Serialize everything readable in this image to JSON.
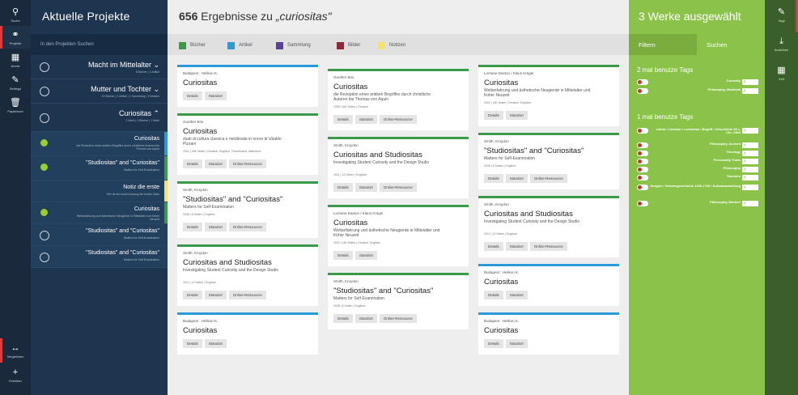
{
  "left_rail": {
    "items": [
      {
        "icon": "search-icon",
        "glyph": "⚲",
        "label": "Suche"
      },
      {
        "icon": "link-icon",
        "glyph": "⚭",
        "label": "Projekte"
      },
      {
        "icon": "grid-icon",
        "glyph": "▦",
        "label": "Archiv"
      },
      {
        "icon": "wrench-icon",
        "glyph": "✎",
        "label": "Settings"
      },
      {
        "icon": "trash-icon",
        "glyph": "🗑",
        "label": "Papierkorb"
      }
    ],
    "bottom": [
      {
        "icon": "compare-icon",
        "glyph": "↔",
        "label": "Vergleichen"
      },
      {
        "icon": "plus-icon",
        "glyph": "+",
        "label": "Erstellen"
      }
    ]
  },
  "projects_panel": {
    "title": "Aktuelle Projekte",
    "search_placeholder": "In den Projekten Suchen",
    "projects": [
      {
        "name": "Macht im Mittelalter ⌄",
        "meta": "8 Bücher | 1 Artikel",
        "filled": false,
        "stripe": ""
      },
      {
        "name": "Mutter und Tochter ⌄",
        "meta": "10 Bücher | 1 Artikel | 1 Sammlung | 3 Notizen",
        "filled": false,
        "stripe": ""
      },
      {
        "name": "Curiositas ⌃",
        "meta": "1 Werk | 4 Bücher | 1 Notiz",
        "filled": false,
        "stripe": ""
      },
      {
        "name": "Curiositas",
        "meta": "die Rezeption eines antiken Begriffes durch christliche Autoren bis Thomas von Aquin",
        "filled": true,
        "stripe": "#2b9ad8"
      },
      {
        "name": "\"Studiositas\" and \"Curiositas\"",
        "meta": "Matters for Self-Examination",
        "filled": true,
        "stripe": "#3a9a4a"
      },
      {
        "name": "Notiz die erste",
        "meta": "Hier ist ein kurzer Auszug der ersten Notiz",
        "filled": false,
        "nodot": true,
        "stripe": "#f3e36b"
      },
      {
        "name": "Curiositas",
        "meta": "Weltanfahrung und ästhetische Neugierde in Mittelalter und früher Neuzeit",
        "filled": true,
        "stripe": "#3a9a4a"
      },
      {
        "name": "\"Studiositas\" and \"Curiositas\"",
        "meta": "Matters for Self-Examination",
        "filled": false,
        "stripe": ""
      },
      {
        "name": "\"Studiositas\" and \"Curiositas\"",
        "meta": "Matters for Self-Examination",
        "filled": false,
        "stripe": ""
      }
    ]
  },
  "main": {
    "count": "656",
    "title_mid": " Ergebnisse zu ",
    "query": "„curiositas\"",
    "legend": [
      {
        "label": "Bücher",
        "color": "#3a9a4a"
      },
      {
        "label": "Artikel",
        "color": "#2b9ad8"
      },
      {
        "label": "Sammlung",
        "color": "#5b3f99"
      },
      {
        "label": "Bilder",
        "color": "#8b2a3a"
      },
      {
        "label": "Notizen",
        "color": "#f3e36b"
      }
    ],
    "buttons": {
      "details": "Details",
      "standort": "Standort",
      "online": "Online-Ressource"
    },
    "cards": [
      {
        "col": 0,
        "author": "Budapest : Helikon K.",
        "title": "Curiositas",
        "subtitle": "",
        "imprint": "",
        "online": false,
        "color": "#2b9ad8"
      },
      {
        "col": 0,
        "author": "Gunther Bös",
        "title": "Curiositas",
        "subtitle": "studi di cultura classica e medievale in onore di Ubaldo Pizzani",
        "imprint": "2002 | 468 Seiten | Deutsch, Englisch, Französisch, Italienisch",
        "online": true,
        "color": "#3a9a4a"
      },
      {
        "col": 0,
        "author": "Smith, Kroydon",
        "title": "\"Studiositas\" and \"Curiositas\"",
        "subtitle": "Matters for Self-Examination",
        "imprint": "2008 | 8 Seiten | Englisch",
        "online": true,
        "color": "#3a9a4a"
      },
      {
        "col": 0,
        "author": "Smith, Kroydon",
        "title": "Curiositas and Studiositas",
        "subtitle": "Investigating Student Curiosity and the Design Studio",
        "imprint": "2011 | 14 Seiten | Englisch",
        "online": true,
        "color": "#3a9a4a"
      },
      {
        "col": 0,
        "author": "Budapest : Helikon K.",
        "title": "Curiositas",
        "subtitle": "",
        "imprint": "",
        "online": false,
        "color": "#2b9ad8"
      },
      {
        "col": 1,
        "author": "Gunther Bös",
        "title": "Curiositas",
        "subtitle": "die Rezeption eines antiken Begriffes durch christliche Autoren bis Thomas von Aquin",
        "imprint": "1995 | 342 Seiten | Deutsch",
        "online": true,
        "color": "#3a9a4a"
      },
      {
        "col": 1,
        "author": "Smith, Kroydon",
        "title": "Curiositas and Studiositas",
        "subtitle": "Investigating Student Curiosity and the Design Studio",
        "imprint": "2011 | 14 Seiten | Englisch",
        "online": true,
        "color": "#3a9a4a"
      },
      {
        "col": 1,
        "author": "Lorraine Daston / Klaus Krüger",
        "title": "Curiositas",
        "subtitle": "Weltanfahrung und ästhetische Neugierde in Mittelalter und früher Neuzeit",
        "imprint": "2002 | 180 Seiten | Deutsch, Englisch",
        "online": false,
        "color": "#3a9a4a"
      },
      {
        "col": 1,
        "author": "Smith, Kroydon",
        "title": "\"Studiositas\" and \"Curiositas\"",
        "subtitle": "Matters for Self-Examination",
        "imprint": "2008 | 8 Seiten | Englisch",
        "online": true,
        "color": "#3a9a4a"
      },
      {
        "col": 2,
        "author": "Lorraine Daston / Klaus Krüger",
        "title": "Curiositas",
        "subtitle": "Weltanfahrung und ästhetische Neugierde in Mittelalter und früher Neuzeit",
        "imprint": "2002 | 180 Seiten | Deutsch, Englisch",
        "online": false,
        "color": "#3a9a4a"
      },
      {
        "col": 2,
        "author": "Smith, Kroydon",
        "title": "\"Studiositas\" and \"Curiositas\"",
        "subtitle": "Matters for Self-Examination",
        "imprint": "2008 | 8 Seiten | Englisch",
        "online": true,
        "color": "#3a9a4a"
      },
      {
        "col": 2,
        "author": "Smith, Kroydon",
        "title": "Curiositas and Studiositas",
        "subtitle": "Investigating Student Curiosity and the Design Studio",
        "imprint": "2011 | 14 Seiten | Englisch",
        "online": true,
        "color": "#3a9a4a"
      },
      {
        "col": 2,
        "author": "Budapest : Helikon K.",
        "title": "Curiositas",
        "subtitle": "",
        "imprint": "",
        "online": false,
        "color": "#2b9ad8"
      },
      {
        "col": 2,
        "author": "Budapest : Helikon K.",
        "title": "Curiositas",
        "subtitle": "",
        "imprint": "",
        "online": false,
        "color": "#2b9ad8"
      }
    ]
  },
  "side": {
    "title": "3 Werke ausgewählt",
    "tabs": [
      "Filtern",
      "Suchen"
    ],
    "section_two": "2 mal benutze Tags",
    "tags_two": [
      {
        "label": "Curiosity",
        "count": "2"
      },
      {
        "label": "Philosophy, Medieval",
        "count": "2"
      }
    ],
    "section_one": "1 mal benutze Tags",
    "tags_one": [
      {
        "label": "Latein / Literatur / curiositas / Begriff / Geschichte 50 v. Chr.-1300",
        "count": "1"
      },
      {
        "label": "Philosophy, Ancient",
        "count": "1"
      },
      {
        "label": "Theology",
        "count": "1"
      },
      {
        "label": "Personality Traits",
        "count": "1"
      },
      {
        "label": "Philosophy",
        "count": "1"
      },
      {
        "label": "Teachers",
        "count": "1"
      },
      {
        "label": "Neugier / Geistesgeschichte 1400-1700 / Aufsatzsammlung",
        "count": "1"
      },
      {
        "label": "Philosophy, Modern",
        "count": "1"
      }
    ]
  },
  "right_rail": {
    "items": [
      {
        "icon": "tag-icon",
        "glyph": "✎",
        "label": "Tags"
      },
      {
        "icon": "export-icon",
        "glyph": "⤓",
        "label": "Ausleihen"
      },
      {
        "icon": "calendar-icon",
        "glyph": "▦",
        "label": "Zeit"
      }
    ]
  }
}
